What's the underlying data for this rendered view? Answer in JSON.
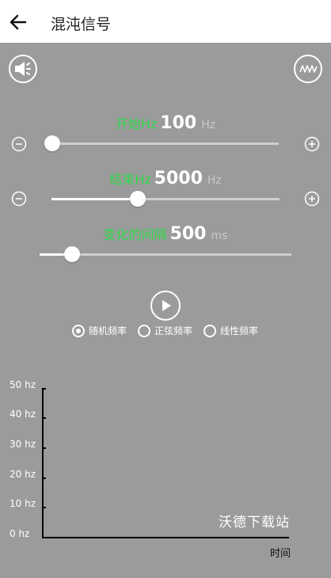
{
  "header": {
    "title": "混沌信号"
  },
  "sliders": [
    {
      "name": "开始Hz",
      "value": "100",
      "unit": "Hz",
      "fraction": 0.0
    },
    {
      "name": "结束Hz",
      "value": "5000",
      "unit": "Hz",
      "fraction": 0.38
    },
    {
      "name": "变化的间隔",
      "value": "500",
      "unit": "ms",
      "fraction": 0.13
    }
  ],
  "modes": [
    {
      "label": "随机频率",
      "selected": true
    },
    {
      "label": "正弦频率",
      "selected": false
    },
    {
      "label": "线性频率",
      "selected": false
    }
  ],
  "chart": {
    "y_ticks": [
      "50 hz",
      "40 hz",
      "30 hz",
      "20 hz",
      "10 hz",
      "0 hz"
    ],
    "x_label": "时间"
  },
  "watermark": "沃德下载站",
  "colors": {
    "accent": "#2fd84a",
    "background": "#9b9b9b"
  }
}
